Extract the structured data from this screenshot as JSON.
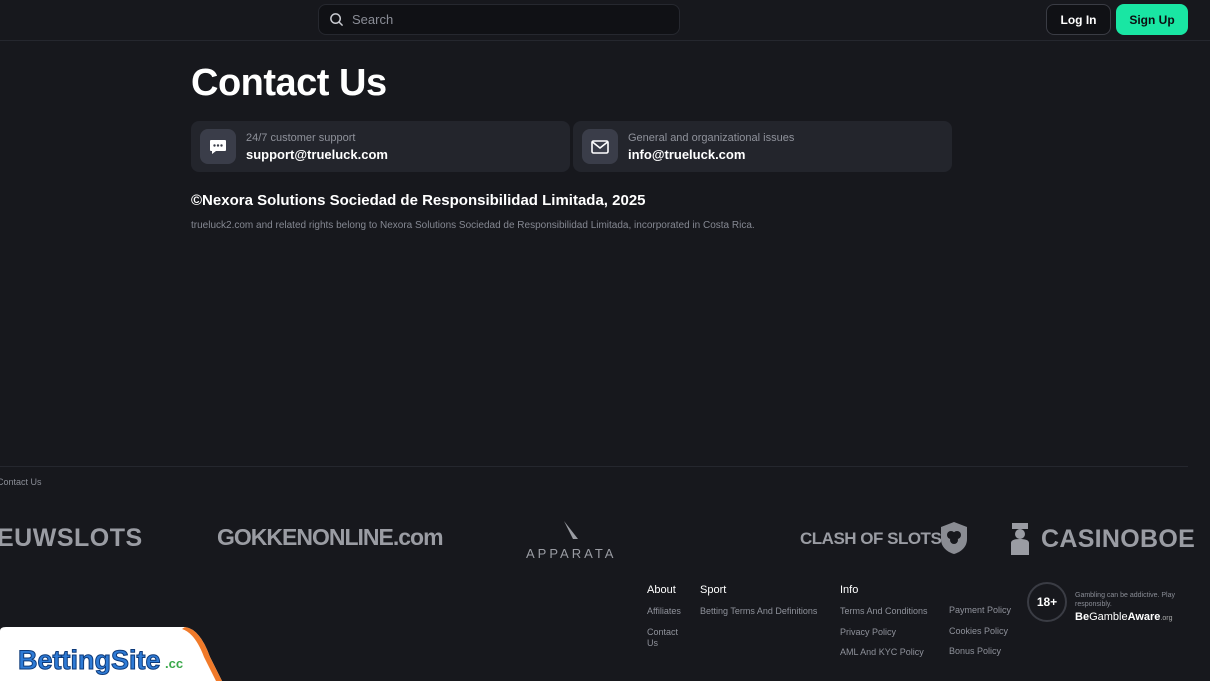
{
  "header": {
    "search_placeholder": "Search",
    "login_label": "Log In",
    "signup_label": "Sign Up"
  },
  "page": {
    "title": "Contact Us"
  },
  "contacts": [
    {
      "label": "24/7 customer support",
      "value": "support@trueluck.com",
      "icon": "chat-icon"
    },
    {
      "label": "General and organizational issues",
      "value": "info@trueluck.com",
      "icon": "mail-icon"
    }
  ],
  "legal": {
    "copyright": "©Nexora Solutions Sociedad de Responsibilidad Limitada, 2025",
    "rights": "trueluck2.com and related rights belong to Nexora Solutions Sociedad de Responsibilidad Limitada, incorporated in Costa Rica."
  },
  "breadcrumb": "Contact Us",
  "partners": [
    "EUWSLOTS",
    "GOKKENONLINE.com",
    "APPARATA",
    "CLASH OF SLOTS",
    "CASINOBOE"
  ],
  "footer": {
    "about": {
      "heading": "About",
      "links": [
        "Affiliates",
        "Contact Us"
      ]
    },
    "sport": {
      "heading": "Sport",
      "links": [
        "Betting Terms And Definitions"
      ]
    },
    "info": {
      "heading": "Info",
      "links_a": [
        "Terms And Conditions",
        "Privacy Policy",
        "AML And KYC Policy"
      ],
      "links_b": [
        "Payment Policy",
        "Cookies Policy",
        "Bonus Policy"
      ]
    },
    "age_badge": "18+",
    "gambling_note": "Gambling can be addictive. Play responsibly.",
    "begambleaware_prefix": "Be",
    "begambleaware_gamble": "Gamble",
    "begambleaware_aware": "Aware",
    "begambleaware_org": ".org"
  },
  "banner": {
    "brand": "BettingSite",
    "tld": ".cc"
  },
  "colors": {
    "background": "#17181d",
    "card": "#23252c",
    "accent": "#19e6a3"
  }
}
